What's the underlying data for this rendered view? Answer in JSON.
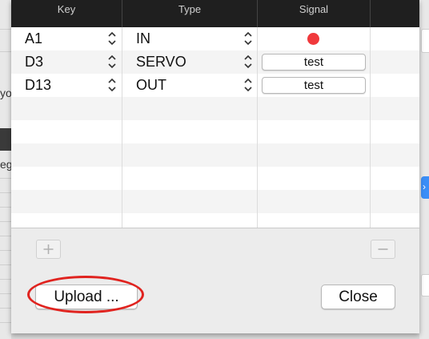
{
  "background": {
    "left_text_1": "yo",
    "left_text_2": "eg"
  },
  "dialog": {
    "columns": [
      {
        "label": "Key"
      },
      {
        "label": "Type"
      },
      {
        "label": "Signal"
      }
    ],
    "rows": [
      {
        "key": "A1",
        "type": "IN",
        "signal_kind": "indicator",
        "signal_color": "#f0393c"
      },
      {
        "key": "D3",
        "type": "SERVO",
        "signal_kind": "button",
        "signal_label": "test"
      },
      {
        "key": "D13",
        "type": "OUT",
        "signal_kind": "button",
        "signal_label": "test"
      }
    ],
    "add_label": "+",
    "remove_label": "—",
    "upload_label": "Upload ...",
    "close_label": "Close",
    "highlight_color": "#e0231f"
  }
}
